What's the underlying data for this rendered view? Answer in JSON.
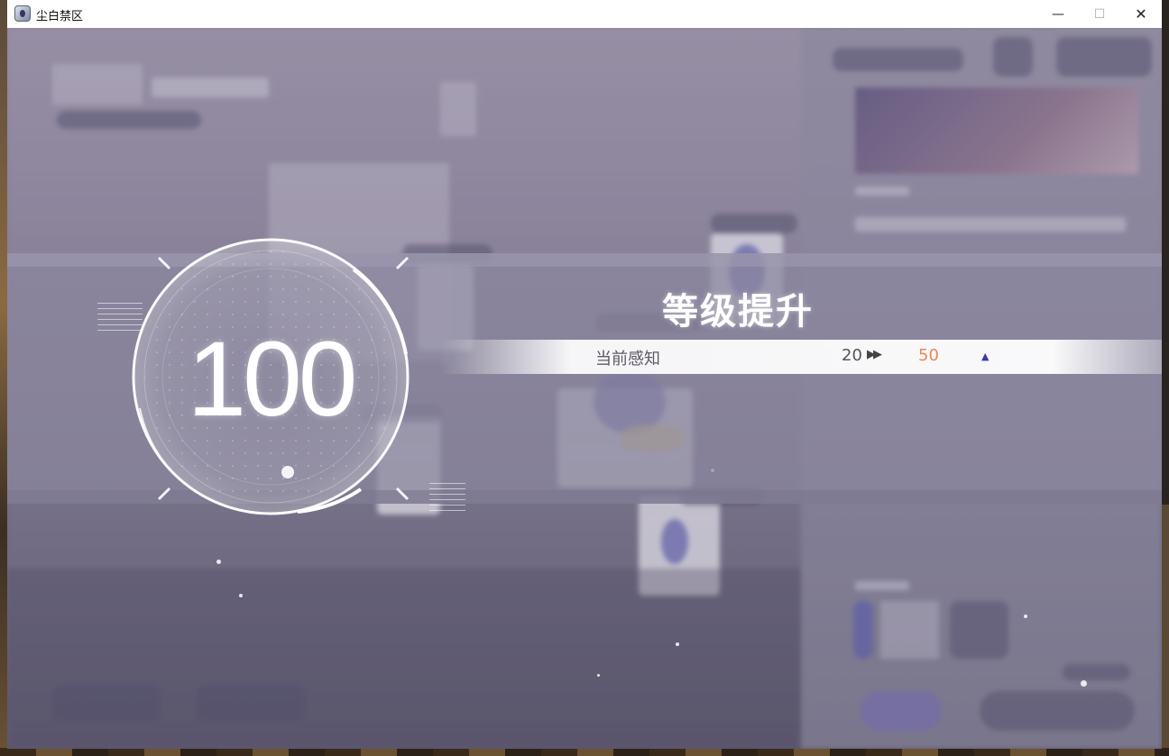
{
  "window": {
    "title": "尘白禁区",
    "controls": {
      "minimize": "—",
      "maximize": "☐",
      "close": "✕"
    }
  },
  "level_up": {
    "title": "等级提升",
    "level": "100",
    "stat": {
      "label": "当前感知",
      "old_value": "20",
      "arrow": "▶▶",
      "new_value": "50",
      "up_indicator": "▲"
    }
  },
  "colors": {
    "new_value": "#e88850",
    "up_indicator": "#3a3ab0",
    "band": "#8a869e"
  },
  "icons": [
    "app-icon",
    "fast-forward-icon",
    "up-triangle-icon"
  ]
}
